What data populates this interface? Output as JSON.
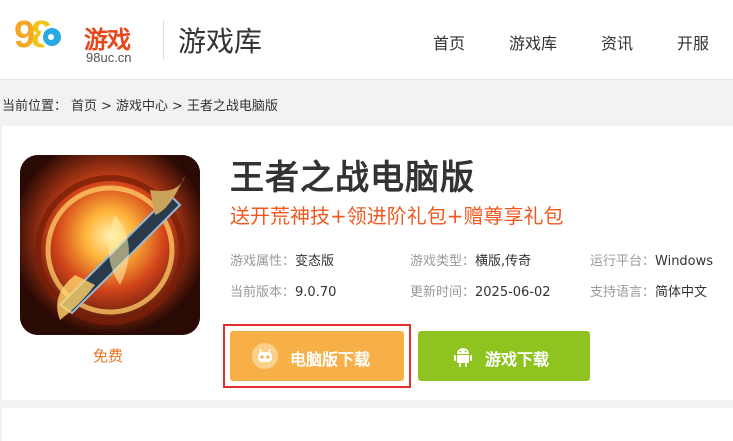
{
  "header": {
    "logo": {
      "digits": "98",
      "brand": "游戏",
      "domain": "98uc.cn"
    },
    "section_title": "游戏库",
    "nav": [
      {
        "label": "首页"
      },
      {
        "label": "游戏库"
      },
      {
        "label": "资讯"
      },
      {
        "label": "开服"
      }
    ]
  },
  "breadcrumb": {
    "prefix": "当前位置：",
    "items": [
      "首页",
      "游戏中心",
      "王者之战电脑版"
    ],
    "separator": ">"
  },
  "game": {
    "title": "王者之战电脑版",
    "slogan": "送开荒神技+领进阶礼包+赠尊享礼包",
    "price_label": "免费",
    "attributes": [
      {
        "key": "游戏属性：",
        "value": "变态版"
      },
      {
        "key": "游戏类型：",
        "value": "横版,传奇"
      },
      {
        "key": "运行平台：",
        "value": "Windows"
      },
      {
        "key": "当前版本：",
        "value": "9.0.70"
      },
      {
        "key": "更新时间：",
        "value": "2025-06-02"
      },
      {
        "key": "支持语言：",
        "value": "简体中文"
      }
    ]
  },
  "buttons": {
    "pc_download": "电脑版下载",
    "game_download": "游戏下载"
  },
  "colors": {
    "accent_orange": "#f05a22",
    "pc_button": "#f7b048",
    "game_button": "#8fc31f",
    "highlight_border": "#e0302d"
  },
  "icons": {
    "pc_button_icon": "gamepad-robot-icon",
    "game_button_icon": "android-icon"
  }
}
